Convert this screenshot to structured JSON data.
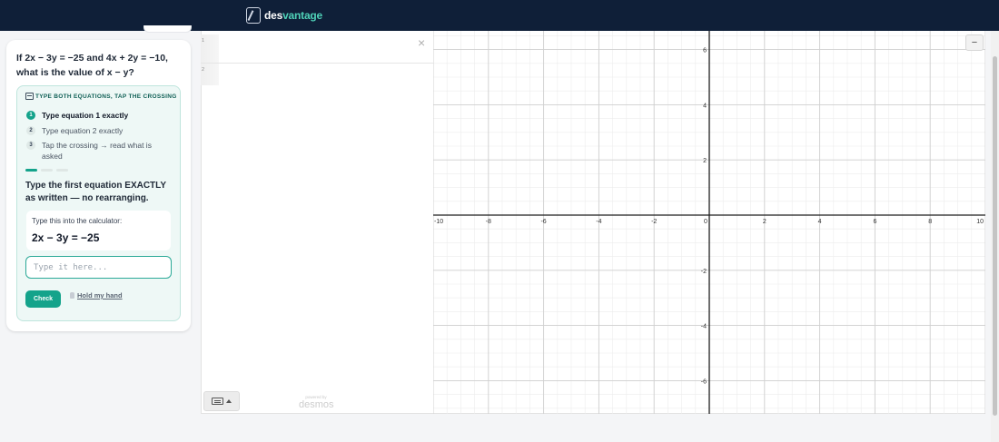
{
  "app": {
    "brand_prefix": "des",
    "brand_suffix": "vantage"
  },
  "question": {
    "text": "If 2x − 3y = −25 and 4x + 2y = −10, what is the value of x − y?"
  },
  "coach": {
    "heading": "TYPE BOTH EQUATIONS, TAP THE CROSSING",
    "steps": [
      {
        "num": "1",
        "label": "Type equation 1 exactly",
        "active": true
      },
      {
        "num": "2",
        "label": "Type equation 2 exactly",
        "active": false
      },
      {
        "num": "3",
        "label": "Tap the crossing → read what is asked",
        "active": false
      }
    ],
    "progress_fraction": 0.333,
    "instruction": "Type the first equation EXACTLY as written — no rearranging.",
    "hint_label": "Type this into the calculator:",
    "hint_equation": "2x − 3y = −25",
    "input_value": "",
    "input_placeholder": "Type it here...",
    "check_label": "Check",
    "hold_label": "Hold my hand"
  },
  "calculator": {
    "expression_rows": [
      "1",
      "2"
    ],
    "powered_by": "powered by",
    "brand": "desmos",
    "zoom_out_label": "−",
    "close_symbol": "×",
    "graph": {
      "x_range": [
        -10,
        10
      ],
      "y_range": [
        -7,
        7
      ],
      "x_ticks": [
        -10,
        -8,
        -6,
        -4,
        -2,
        0,
        2,
        4,
        6,
        8,
        10
      ],
      "y_ticks": [
        6,
        4,
        2,
        -2,
        -4,
        -6
      ],
      "grid": true,
      "colors": {
        "minor_grid": "#ececec",
        "major_grid": "#cfcfcf",
        "axis": "#1e1e1e",
        "label": "#333333"
      }
    }
  }
}
